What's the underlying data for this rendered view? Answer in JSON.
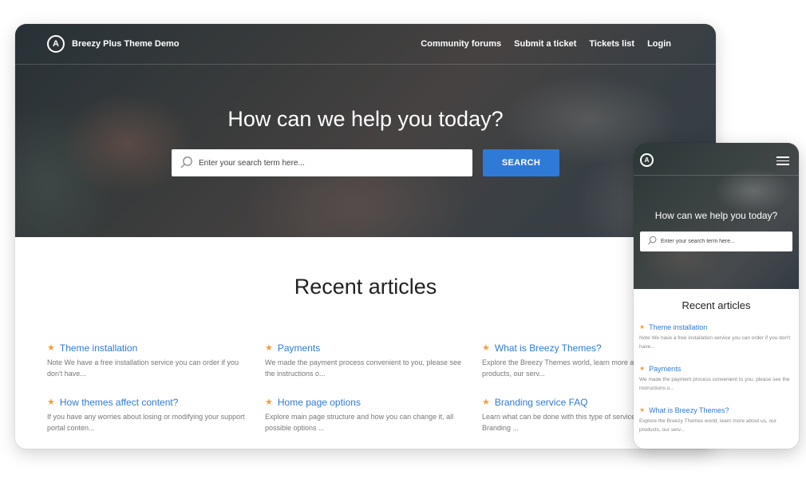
{
  "desktop": {
    "brand": "Breezy Plus Theme Demo",
    "logo_letter": "A",
    "nav": [
      "Community forums",
      "Submit a ticket",
      "Tickets list",
      "Login"
    ],
    "hero_title": "How can we help you today?",
    "search_placeholder": "Enter your search term here...",
    "search_button": "SEARCH",
    "section_title": "Recent articles",
    "articles": [
      {
        "title": "Theme installation",
        "excerpt": "Note We have a free installation service you can order if you don't have..."
      },
      {
        "title": "Payments",
        "excerpt": "We made the payment process convenient to you, please see the instructions o..."
      },
      {
        "title": "What is Breezy Themes?",
        "excerpt": "Explore the Breezy Themes world, learn more about us, our products, our serv..."
      },
      {
        "title": "How themes affect content?",
        "excerpt": "If you have any worries about losing or modifying your support portal conten..."
      },
      {
        "title": "Home page options",
        "excerpt": "Explore main page structure and how you can change it, all possible options ..."
      },
      {
        "title": "Branding service FAQ",
        "excerpt": "Learn what can be done with this type of service with Our Branding ..."
      }
    ]
  },
  "mobile": {
    "logo_letter": "A",
    "hero_title": "How can we help you today?",
    "search_placeholder": "Enter your search term here...",
    "section_title": "Recent articles",
    "articles": [
      {
        "title": "Theme installation",
        "excerpt": "Note We have a free installation service you can order if you don't have..."
      },
      {
        "title": "Payments",
        "excerpt": "We made the payment process convenient to you, please see the instructions o..."
      },
      {
        "title": "What is Breezy Themes?",
        "excerpt": "Explore the Breezy Themes world, learn more about us, our products, our serv..."
      }
    ]
  },
  "colors": {
    "accent": "#2f7ad6",
    "star": "#f5a033"
  },
  "icons": [
    "logo-icon",
    "search-icon",
    "star-icon",
    "hamburger-menu-icon"
  ]
}
